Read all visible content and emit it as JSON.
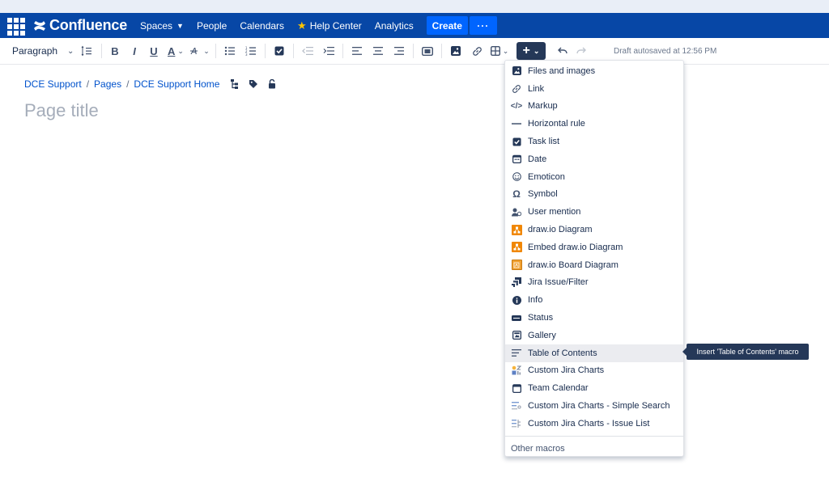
{
  "nav": {
    "product": "Confluence",
    "items": [
      {
        "label": "Spaces",
        "has_chevron": true
      },
      {
        "label": "People"
      },
      {
        "label": "Calendars"
      },
      {
        "label": "Help Center",
        "icon": "star-icon"
      },
      {
        "label": "Analytics"
      }
    ],
    "create_label": "Create",
    "more_label": "···"
  },
  "toolbar": {
    "paragraph_label": "Paragraph",
    "bold": "B",
    "italic": "I",
    "underline": "U",
    "text_color": "A",
    "insert_label": "+",
    "autosave": "Draft autosaved at 12:56 PM"
  },
  "breadcrumb": {
    "items": [
      "DCE Support",
      "Pages",
      "DCE Support Home"
    ]
  },
  "page": {
    "title_placeholder": "Page title"
  },
  "insert_menu": {
    "items": [
      {
        "label": "Files and images",
        "icon": "image-icon"
      },
      {
        "label": "Link",
        "icon": "link-icon"
      },
      {
        "label": "Markup",
        "icon": "code-icon"
      },
      {
        "label": "Horizontal rule",
        "icon": "horizontal-rule-icon"
      },
      {
        "label": "Task list",
        "icon": "checkbox-icon"
      },
      {
        "label": "Date",
        "icon": "calendar-icon"
      },
      {
        "label": "Emoticon",
        "icon": "smiley-icon"
      },
      {
        "label": "Symbol",
        "icon": "omega-icon"
      },
      {
        "label": "User mention",
        "icon": "user-mention-icon"
      },
      {
        "label": "draw.io Diagram",
        "icon": "drawio-icon"
      },
      {
        "label": "Embed draw.io Diagram",
        "icon": "drawio-embed-icon"
      },
      {
        "label": "draw.io Board Diagram",
        "icon": "drawio-board-icon"
      },
      {
        "label": "Jira Issue/Filter",
        "icon": "jira-icon"
      },
      {
        "label": "Info",
        "icon": "info-icon"
      },
      {
        "label": "Status",
        "icon": "status-icon"
      },
      {
        "label": "Gallery",
        "icon": "gallery-icon"
      },
      {
        "label": "Table of Contents",
        "icon": "toc-icon"
      },
      {
        "label": "Custom Jira Charts",
        "icon": "jira-charts-icon"
      },
      {
        "label": "Team Calendar",
        "icon": "team-calendar-icon"
      },
      {
        "label": "Custom Jira Charts - Simple Search",
        "icon": "jira-charts-search-icon"
      },
      {
        "label": "Custom Jira Charts - Issue List",
        "icon": "jira-charts-list-icon"
      }
    ],
    "other_label": "Other macros",
    "hovered_index": 16
  },
  "tooltip": {
    "text": "Insert 'Table of Contents' macro"
  },
  "colors": {
    "nav_bg": "#0747a6",
    "create_bg": "#0065ff",
    "insert_button_bg": "#253858",
    "link": "#0052cc"
  }
}
